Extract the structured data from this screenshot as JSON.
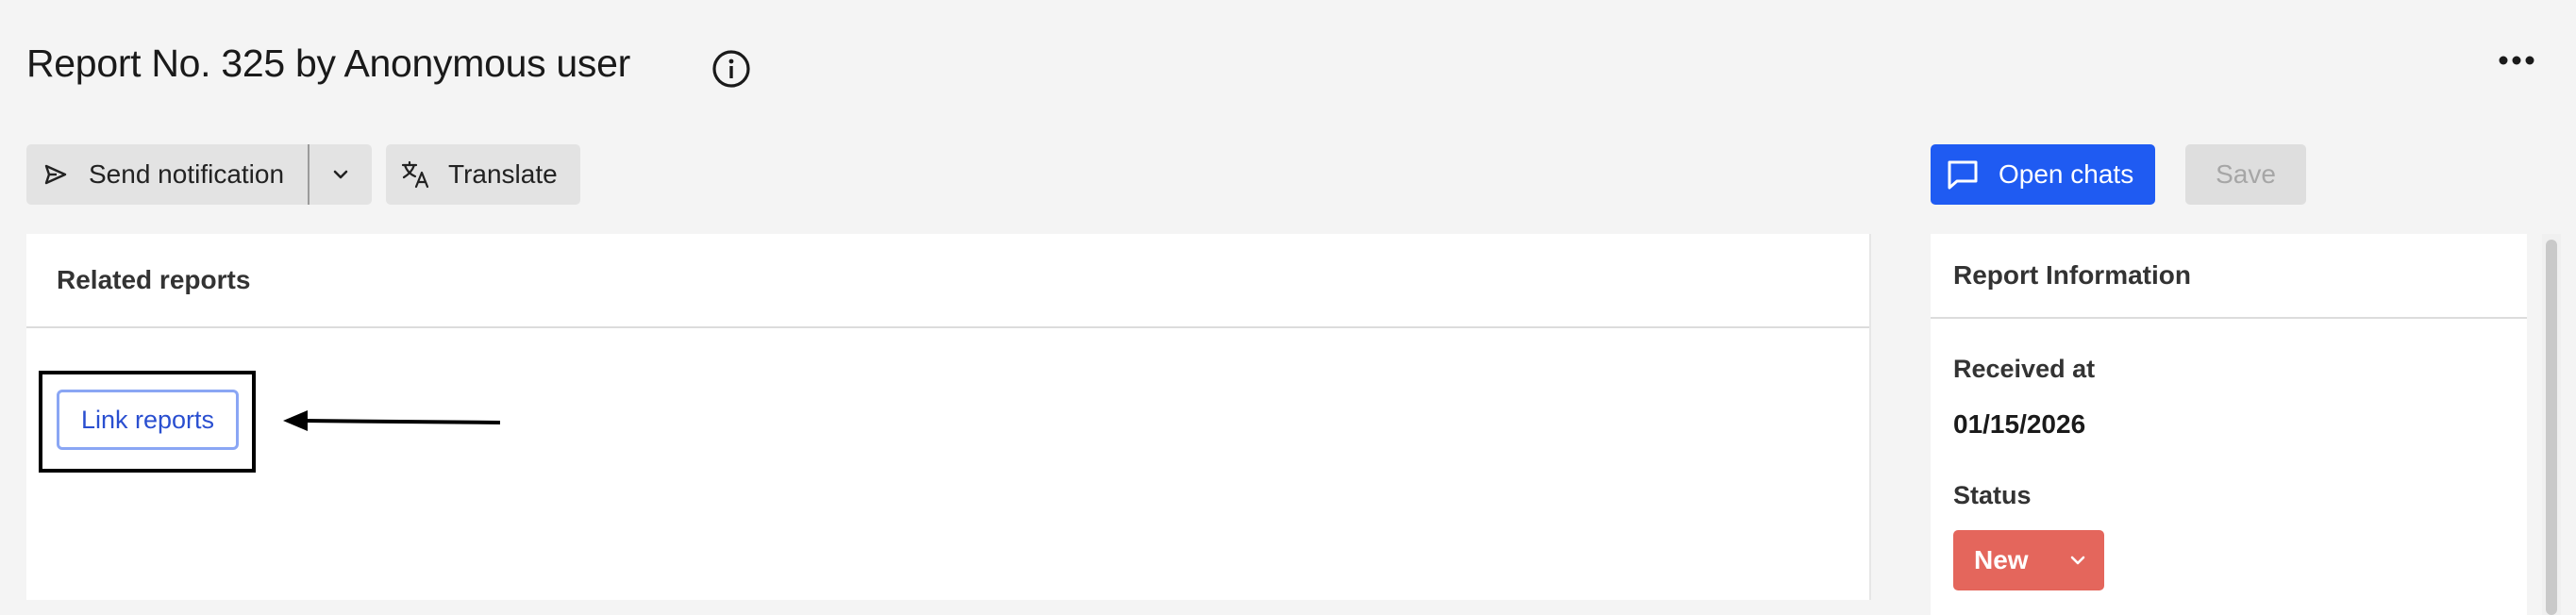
{
  "header": {
    "title": "Report No. 325 by Anonymous user",
    "info_icon": "info-circle-icon",
    "more_icon": "more-horizontal-icon"
  },
  "toolbar": {
    "send_notification_label": "Send notification",
    "send_icon": "send-icon",
    "dropdown_icon": "chevron-down-icon",
    "translate_label": "Translate",
    "translate_icon": "translate-icon",
    "open_chats_label": "Open chats",
    "open_chats_icon": "chat-icon",
    "save_label": "Save"
  },
  "related_reports": {
    "heading": "Related reports",
    "link_reports_label": "Link reports"
  },
  "report_information": {
    "heading": "Report Information",
    "received_at_label": "Received at",
    "received_at_value": "01/15/2026",
    "status_label": "Status",
    "status_value": "New"
  },
  "colors": {
    "primary": "#1f5bf2",
    "status_new": "#e4665c",
    "background": "#f4f4f4",
    "link_text": "#2a4fd0"
  }
}
